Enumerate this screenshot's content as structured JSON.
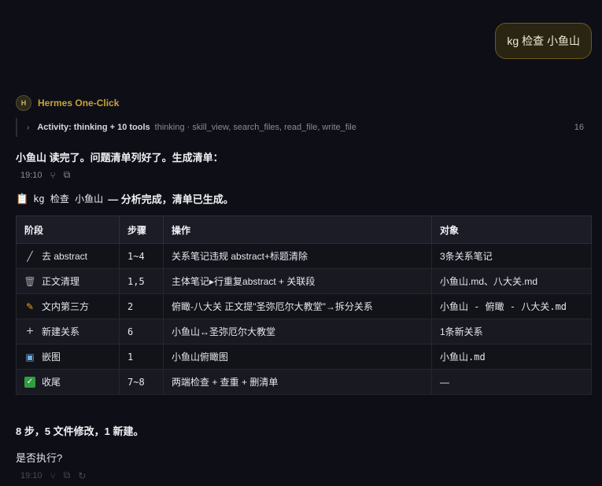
{
  "user_message": "kg 检查 小鱼山",
  "agent": {
    "avatar_letter": "H",
    "name": "Hermes One-Click"
  },
  "activity": {
    "title": "Activity: thinking + 10 tools",
    "detail": "thinking · skill_view, search_files, read_file, write_file",
    "count": "16"
  },
  "reply": {
    "text": "小鱼山 读完了。问题清单列好了。生成清单：",
    "time": "19:10"
  },
  "summary": {
    "icon": "clipboard-icon",
    "command": "kg 检查 小鱼山",
    "text": "— 分析完成，清单已生成。"
  },
  "table": {
    "headers": [
      "阶段",
      "步骤",
      "操作",
      "对象"
    ],
    "rows": [
      {
        "icon": "wand-icon",
        "glyph": "／",
        "stage": "去 abstract",
        "step": "1~4",
        "action": "关系笔记违规 abstract+标题清除",
        "target": "3条关系笔记"
      },
      {
        "icon": "trash-icon",
        "glyph": "🗑",
        "stage": "正文清理",
        "step": "1,5",
        "action": "主体笔记▸行重复abstract + 关联段",
        "target": "小鱼山.md、八大关.md"
      },
      {
        "icon": "pencil-icon",
        "glyph": "✎",
        "stage": "文内第三方",
        "step": "2",
        "action": "俯瞰-八大关 正文提\"圣弥厄尔大教堂\"→拆分关系",
        "target": "小鱼山 - 俯瞰 - 八大关.md"
      },
      {
        "icon": "plus-icon",
        "glyph": "+",
        "stage": "新建关系",
        "step": "6",
        "action": "小鱼山↔圣弥厄尔大教堂",
        "target": "1条新关系"
      },
      {
        "icon": "image-icon",
        "glyph": "▣",
        "stage": "嵌图",
        "step": "1",
        "action": "小鱼山俯瞰图",
        "target": "小鱼山.md"
      },
      {
        "icon": "check-icon",
        "glyph": "✓",
        "stage": "收尾",
        "step": "7~8",
        "action": "两端检查 + 查重 + 删清单",
        "target": "—"
      }
    ]
  },
  "footer": {
    "stats": "8 步，5 文件修改，1 新建。",
    "question": "是否执行?",
    "time": "19:10"
  }
}
